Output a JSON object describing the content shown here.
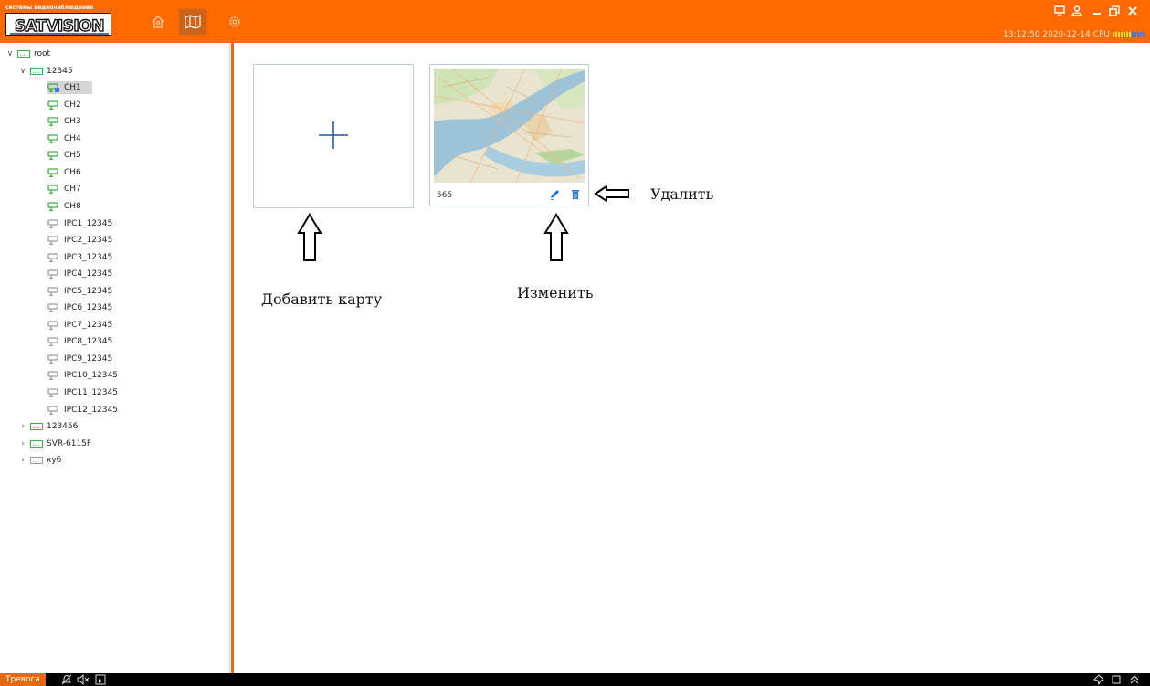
{
  "header": {
    "logo_caption": "системы видеонаблюдения",
    "logo_text": "SATVISION",
    "nav": [
      {
        "name": "home",
        "icon": "home-icon",
        "active": false
      },
      {
        "name": "map",
        "icon": "map-icon",
        "active": true
      },
      {
        "name": "settings",
        "icon": "gear-icon",
        "active": false
      }
    ],
    "clock": "13:12:50 2020-12-14",
    "cpu_label": "CPU"
  },
  "tree": [
    {
      "label": "root",
      "level": 0,
      "type": "device",
      "expanded": true
    },
    {
      "label": "12345",
      "level": 1,
      "type": "device",
      "expanded": true
    },
    {
      "label": "CH1",
      "level": 2,
      "type": "camera-online",
      "selected": true
    },
    {
      "label": "CH2",
      "level": 2,
      "type": "camera-online"
    },
    {
      "label": "CH3",
      "level": 2,
      "type": "camera-online"
    },
    {
      "label": "CH4",
      "level": 2,
      "type": "camera-online"
    },
    {
      "label": "CH5",
      "level": 2,
      "type": "camera-online"
    },
    {
      "label": "CH6",
      "level": 2,
      "type": "camera-online"
    },
    {
      "label": "CH7",
      "level": 2,
      "type": "camera-online"
    },
    {
      "label": "CH8",
      "level": 2,
      "type": "camera-online"
    },
    {
      "label": "IPC1_12345",
      "level": 2,
      "type": "camera-offline"
    },
    {
      "label": "IPC2_12345",
      "level": 2,
      "type": "camera-offline"
    },
    {
      "label": "IPC3_12345",
      "level": 2,
      "type": "camera-offline"
    },
    {
      "label": "IPC4_12345",
      "level": 2,
      "type": "camera-offline"
    },
    {
      "label": "IPC5_12345",
      "level": 2,
      "type": "camera-offline"
    },
    {
      "label": "IPC6_12345",
      "level": 2,
      "type": "camera-offline"
    },
    {
      "label": "IPC7_12345",
      "level": 2,
      "type": "camera-offline"
    },
    {
      "label": "IPC8_12345",
      "level": 2,
      "type": "camera-offline"
    },
    {
      "label": "IPC9_12345",
      "level": 2,
      "type": "camera-offline"
    },
    {
      "label": "IPC10_12345",
      "level": 2,
      "type": "camera-offline"
    },
    {
      "label": "IPC11_12345",
      "level": 2,
      "type": "camera-offline"
    },
    {
      "label": "IPC12_12345",
      "level": 2,
      "type": "camera-offline"
    },
    {
      "label": "123456",
      "level": 1,
      "type": "device",
      "expanded": false
    },
    {
      "label": "SVR-6115F",
      "level": 1,
      "type": "device",
      "expanded": false
    },
    {
      "label": "куб",
      "level": 1,
      "type": "device-offline",
      "expanded": false
    }
  ],
  "main": {
    "add_card_icon": "plus-icon",
    "map_card": {
      "name": "565",
      "edit_icon": "pencil-icon",
      "delete_icon": "trash-icon"
    }
  },
  "annotations": {
    "delete": "Удалить",
    "add_map": "Добавить карту",
    "edit": "Изменить"
  },
  "footer": {
    "alarm_label": "Тревога"
  },
  "colors": {
    "accent": "#ff6a00",
    "online": "#3cb043",
    "offline": "#9a9a9a",
    "icon_blue": "#1f6fd6"
  }
}
